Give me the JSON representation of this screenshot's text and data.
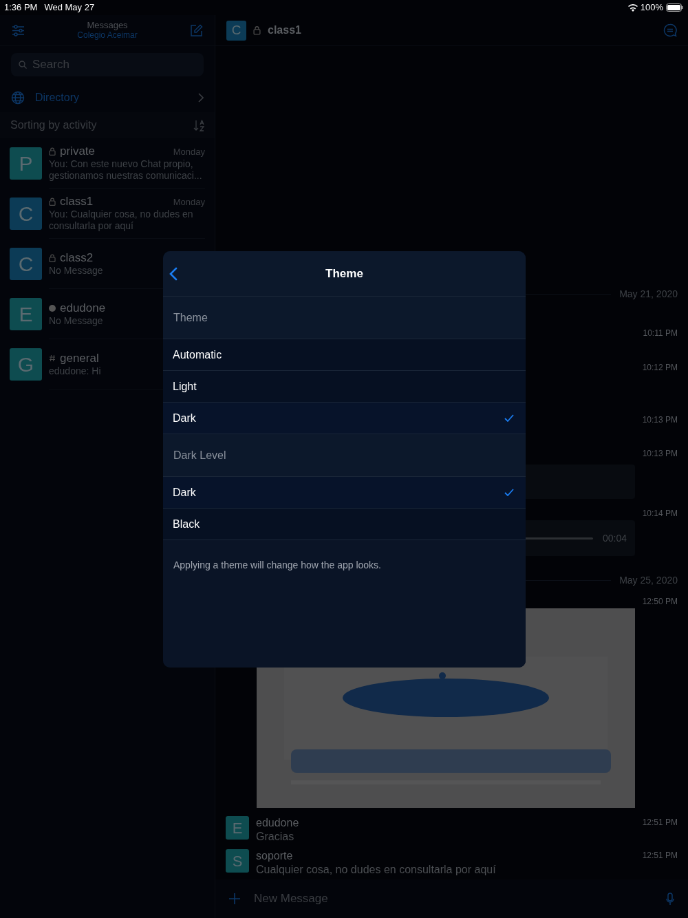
{
  "status_bar": {
    "time": "1:36 PM",
    "date": "Wed May 27",
    "battery": "100%"
  },
  "sidebar": {
    "title": "Messages",
    "subtitle": "Colegio Aceimar",
    "search": {
      "placeholder": "Search"
    },
    "directory": "Directory",
    "sorting": "Sorting by activity",
    "chats": [
      {
        "letter": "P",
        "color": "#0e4c50",
        "kind": "lock",
        "name": "private",
        "time": "Monday",
        "preview": "You: Con este nuevo Chat propio, gestionamos nuestras comunicaci..."
      },
      {
        "letter": "C",
        "color": "#0c3b56",
        "kind": "lock",
        "name": "class1",
        "time": "Monday",
        "preview": "You: Cualquier cosa, no dudes en consultarla por aquí"
      },
      {
        "letter": "C",
        "color": "#0c3b56",
        "kind": "lock",
        "name": "class2",
        "preview": "No Message"
      },
      {
        "letter": "E",
        "color": "#0e4c50",
        "kind": "dot",
        "name": "edudone",
        "preview": "No Message"
      },
      {
        "letter": "G",
        "color": "#0e4c50",
        "kind": "hash",
        "name": "general",
        "preview": "edudone: Hi"
      }
    ]
  },
  "chat": {
    "avatar": {
      "letter": "C",
      "color": "#0c3b56"
    },
    "name": "class1",
    "timeline": [
      {
        "kind": "date",
        "text": "May 21, 2020"
      },
      {
        "kind": "time",
        "text": "10:11 PM"
      },
      {
        "kind": "time",
        "text": "10:12 PM"
      },
      {
        "kind": "time",
        "text": "10:13 PM"
      },
      {
        "kind": "time",
        "text": "10:13 PM"
      },
      {
        "kind": "bubble"
      },
      {
        "kind": "time",
        "text": "10:14 PM"
      },
      {
        "kind": "audio",
        "duration": "00:04"
      },
      {
        "kind": "date",
        "text": "May 25, 2020"
      },
      {
        "kind": "time",
        "text": "12:50 PM"
      },
      {
        "kind": "picture"
      },
      {
        "kind": "message",
        "letter": "E",
        "color": "#0e4c50",
        "author": "edudone",
        "text": "Gracias",
        "time": "12:51 PM"
      },
      {
        "kind": "message",
        "letter": "S",
        "color": "#0e4c50",
        "author": "soporte",
        "text": "Cualquier cosa, no dudes en consultarla por aquí",
        "time": "12:51 PM"
      }
    ],
    "composer": {
      "placeholder": "New Message"
    }
  },
  "modal": {
    "title": "Theme",
    "sections": [
      {
        "header": "Theme",
        "options": [
          {
            "label": "Automatic",
            "selected": false
          },
          {
            "label": "Light",
            "selected": false
          },
          {
            "label": "Dark",
            "selected": true
          }
        ]
      },
      {
        "header": "Dark Level",
        "options": [
          {
            "label": "Dark",
            "selected": true
          },
          {
            "label": "Black",
            "selected": false
          }
        ]
      }
    ],
    "footer": "Applying a theme will change how the app looks."
  }
}
